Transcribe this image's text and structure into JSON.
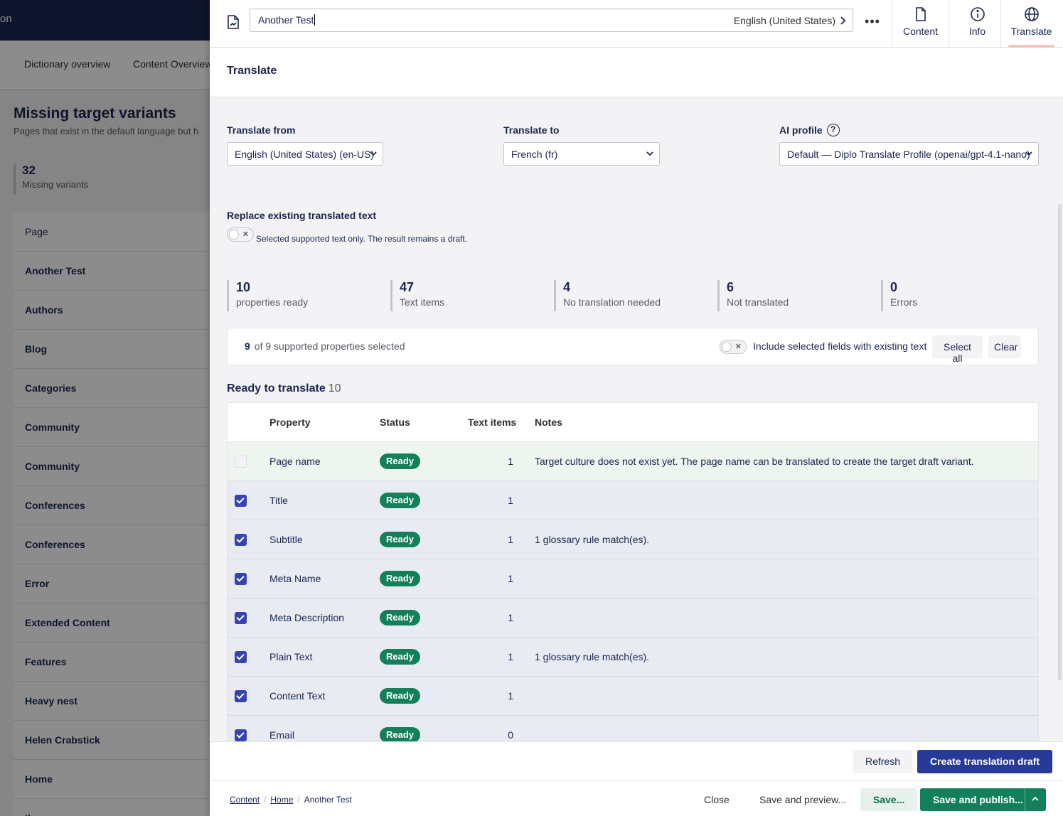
{
  "background": {
    "topbar_text": "on",
    "tabs": [
      "Dictionary overview",
      "Content Overview"
    ],
    "heading": "Missing target variants",
    "subheading": "Pages that exist in the default language but h",
    "count": "32",
    "count_label": "Missing variants",
    "list_header": "Page",
    "pages": [
      "Another Test",
      "Authors",
      "Blog",
      "Categories",
      "Community",
      "Community",
      "Conferences",
      "Conferences",
      "Error",
      "Extended Content",
      "Features",
      "Heavy nest",
      "Helen Crabstick",
      "Home",
      "Il"
    ]
  },
  "header": {
    "name_value": "Another Test",
    "culture": "English (United States)",
    "apps": [
      {
        "label": "Content",
        "icon": "document-icon"
      },
      {
        "label": "Info",
        "icon": "info-icon"
      },
      {
        "label": "Translate",
        "icon": "globe-icon"
      }
    ]
  },
  "panel_title": "Translate",
  "form": {
    "translate_from_label": "Translate from",
    "translate_from_value": "English (United States) (en-US)",
    "translate_to_label": "Translate to",
    "translate_to_value": "French (fr)",
    "ai_profile_label": "AI profile",
    "ai_profile_value": "Default — Diplo Translate Profile (openai/gpt-4.1-nano)",
    "replace_label": "Replace existing translated text",
    "replace_hint": "Selected supported text only. The result remains a draft."
  },
  "stats": [
    {
      "value": "10",
      "label": "properties ready"
    },
    {
      "value": "47",
      "label": "Text items"
    },
    {
      "value": "4",
      "label": "No translation needed"
    },
    {
      "value": "6",
      "label": "Not translated"
    },
    {
      "value": "0",
      "label": "Errors"
    }
  ],
  "selection": {
    "count": "9",
    "text": "of 9 supported properties selected",
    "include_label": "Include selected fields with existing text",
    "select_all": "Select all",
    "clear": "Clear"
  },
  "ready_section": {
    "title": "Ready to translate",
    "count": "10"
  },
  "table": {
    "columns": [
      "Property",
      "Status",
      "Text items",
      "Notes"
    ],
    "rows": [
      {
        "property": "Page name",
        "status": "Ready",
        "items": "1",
        "notes": "Target culture does not exist yet. The page name can be translated to create the target draft variant.",
        "checked": false
      },
      {
        "property": "Title",
        "status": "Ready",
        "items": "1",
        "notes": "",
        "checked": true
      },
      {
        "property": "Subtitle",
        "status": "Ready",
        "items": "1",
        "notes": "1 glossary rule match(es).",
        "checked": true
      },
      {
        "property": "Meta Name",
        "status": "Ready",
        "items": "1",
        "notes": "",
        "checked": true
      },
      {
        "property": "Meta Description",
        "status": "Ready",
        "items": "1",
        "notes": "",
        "checked": true
      },
      {
        "property": "Plain Text",
        "status": "Ready",
        "items": "1",
        "notes": "1 glossary rule match(es).",
        "checked": true
      },
      {
        "property": "Content Text",
        "status": "Ready",
        "items": "1",
        "notes": "",
        "checked": true
      },
      {
        "property": "Email",
        "status": "Ready",
        "items": "0",
        "notes": "",
        "checked": true
      }
    ]
  },
  "actions": {
    "refresh": "Refresh",
    "create_draft": "Create translation draft"
  },
  "footer": {
    "breadcrumbs": [
      "Content",
      "Home",
      "Another Test"
    ],
    "close": "Close",
    "save_preview": "Save and preview...",
    "save": "Save...",
    "save_publish": "Save and publish..."
  },
  "colors": {
    "primary": "#283a97",
    "success": "#14805a",
    "navy": "#1b264f",
    "accent": "#f5c1bc"
  }
}
